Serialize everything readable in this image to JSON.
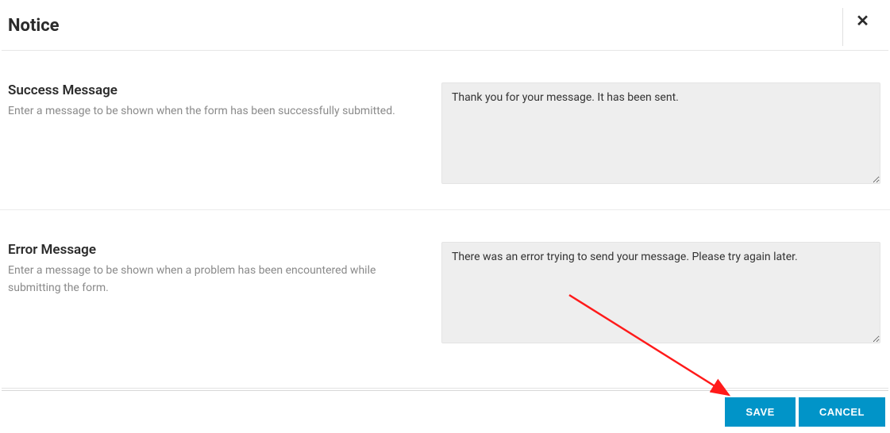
{
  "header": {
    "title": "Notice"
  },
  "sections": {
    "success": {
      "title": "Success Message",
      "description": "Enter a message to be shown when the form has been successfully submitted.",
      "value": "Thank you for your message. It has been sent."
    },
    "error": {
      "title": "Error Message",
      "description": "Enter a message to be shown when a problem has been encountered while submitting the form.",
      "value": "There was an error trying to send your message. Please try again later."
    }
  },
  "footer": {
    "save_label": "SAVE",
    "cancel_label": "CANCEL"
  }
}
